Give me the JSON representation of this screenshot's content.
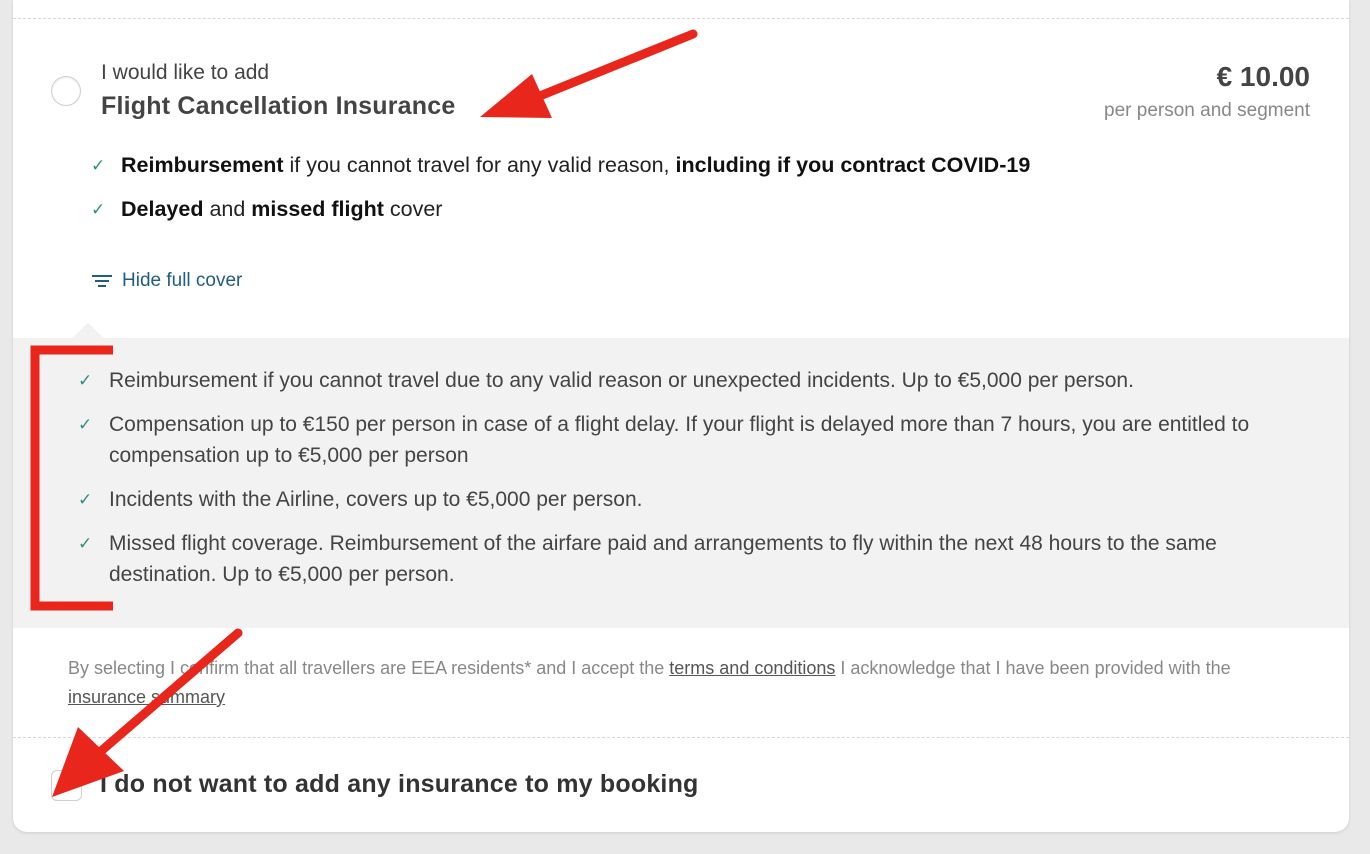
{
  "offer": {
    "intro": "I would like to add",
    "product": "Flight Cancellation Insurance",
    "price": "€ 10.00",
    "price_unit": "per person and segment"
  },
  "highlights": [
    {
      "p1": "Reimbursement",
      "p2": " if you cannot travel for any valid reason, ",
      "p3": "including if you contract COVID-19"
    },
    {
      "p1": "Delayed",
      "p2": " and ",
      "p3": "missed flight",
      "p4": " cover"
    }
  ],
  "toggle_label": "Hide full cover",
  "cover_items": [
    "Reimbursement if you cannot travel due to any valid reason or unexpected incidents. Up to €5,000 per person.",
    "Compensation up to €150 per person in case of a flight delay. If your flight is delayed more than 7 hours, you are entitled to compensation up to €5,000 per person",
    "Incidents with the Airline, covers up to €5,000 per person.",
    "Missed flight coverage. Reimbursement of the airfare paid and arrangements to fly within the next 48 hours to the same destination. Up to €5,000 per person."
  ],
  "legal": {
    "t1": "By selecting I confirm that all travellers are EEA residents* and I accept the ",
    "terms_link": "terms and conditions",
    "t2": " I acknowledge that I have been provided with the ",
    "summary_link": "insurance summary"
  },
  "opt_out": {
    "label": "I do not want to add any insurance to my booking",
    "checked": true
  },
  "colors": {
    "check": "#2f8f7f",
    "link": "#1f5d85",
    "annotation": "#e8261b"
  }
}
